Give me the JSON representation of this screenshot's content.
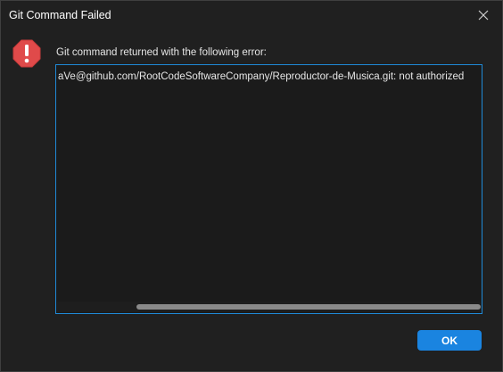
{
  "window": {
    "title": "Git Command Failed",
    "close_icon": "close-icon"
  },
  "dialog": {
    "icon": "error-icon",
    "message": "Git command returned with the following error:",
    "output_text": "aVe@github.com/RootCodeSoftwareCompany/Reproductor-de-Musica.git: not authorized",
    "ok_label": "OK"
  },
  "colors": {
    "background": "#202020",
    "accent": "#1a84e0",
    "error": "#e04a4a"
  }
}
